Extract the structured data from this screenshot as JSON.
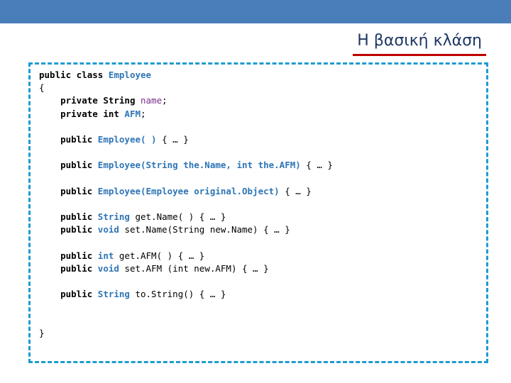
{
  "slide": {
    "title": "Η βασική κλάση",
    "accent_band_color": "#4a7ebb",
    "title_underline_color": "#c00000",
    "title_color": "#1f3864",
    "code_border_color": "#1f9bd0"
  },
  "code": {
    "lines": [
      {
        "indent": 0,
        "tokens": [
          {
            "t": "public class ",
            "c": "kw"
          },
          {
            "t": "Employee",
            "c": "cls"
          }
        ]
      },
      {
        "indent": 0,
        "tokens": [
          {
            "t": "{",
            "c": "plain"
          }
        ]
      },
      {
        "indent": 4,
        "tokens": [
          {
            "t": "private String ",
            "c": "kw"
          },
          {
            "t": "name",
            "c": "id"
          },
          {
            "t": ";",
            "c": "plain"
          }
        ]
      },
      {
        "indent": 4,
        "tokens": [
          {
            "t": "private int ",
            "c": "kw"
          },
          {
            "t": "AFM",
            "c": "type"
          },
          {
            "t": ";",
            "c": "plain"
          }
        ]
      },
      {
        "indent": 0,
        "tokens": []
      },
      {
        "indent": 4,
        "tokens": [
          {
            "t": "public ",
            "c": "kw"
          },
          {
            "t": "Employee( )",
            "c": "cls"
          },
          {
            "t": " { … }",
            "c": "plain"
          }
        ]
      },
      {
        "indent": 0,
        "tokens": []
      },
      {
        "indent": 4,
        "tokens": [
          {
            "t": "public ",
            "c": "kw"
          },
          {
            "t": "Employee(String the.Name, int the.AFM)",
            "c": "cls"
          },
          {
            "t": " { … }",
            "c": "plain"
          }
        ]
      },
      {
        "indent": 0,
        "tokens": []
      },
      {
        "indent": 4,
        "tokens": [
          {
            "t": "public ",
            "c": "kw"
          },
          {
            "t": "Employee(Employee original.Object)",
            "c": "cls"
          },
          {
            "t": " { … }",
            "c": "plain"
          }
        ]
      },
      {
        "indent": 0,
        "tokens": []
      },
      {
        "indent": 4,
        "tokens": [
          {
            "t": "public ",
            "c": "kw"
          },
          {
            "t": "String ",
            "c": "type"
          },
          {
            "t": "get.Name( ) { … }",
            "c": "plain"
          }
        ]
      },
      {
        "indent": 4,
        "tokens": [
          {
            "t": "public ",
            "c": "kw"
          },
          {
            "t": "void ",
            "c": "type"
          },
          {
            "t": "set.Name(String new.Name) { … }",
            "c": "plain"
          }
        ]
      },
      {
        "indent": 0,
        "tokens": []
      },
      {
        "indent": 4,
        "tokens": [
          {
            "t": "public ",
            "c": "kw"
          },
          {
            "t": "int ",
            "c": "type"
          },
          {
            "t": "get.AFM( ) { … }",
            "c": "plain"
          }
        ]
      },
      {
        "indent": 4,
        "tokens": [
          {
            "t": "public ",
            "c": "kw"
          },
          {
            "t": "void ",
            "c": "type"
          },
          {
            "t": "set.AFM (int new.AFM) { … }",
            "c": "plain"
          }
        ]
      },
      {
        "indent": 0,
        "tokens": []
      },
      {
        "indent": 4,
        "tokens": [
          {
            "t": "public ",
            "c": "kw"
          },
          {
            "t": "String ",
            "c": "type"
          },
          {
            "t": "to.String() { … }",
            "c": "plain"
          }
        ]
      },
      {
        "indent": 0,
        "tokens": []
      },
      {
        "indent": 0,
        "tokens": []
      },
      {
        "indent": 0,
        "tokens": [
          {
            "t": "}",
            "c": "plain"
          }
        ]
      }
    ]
  }
}
